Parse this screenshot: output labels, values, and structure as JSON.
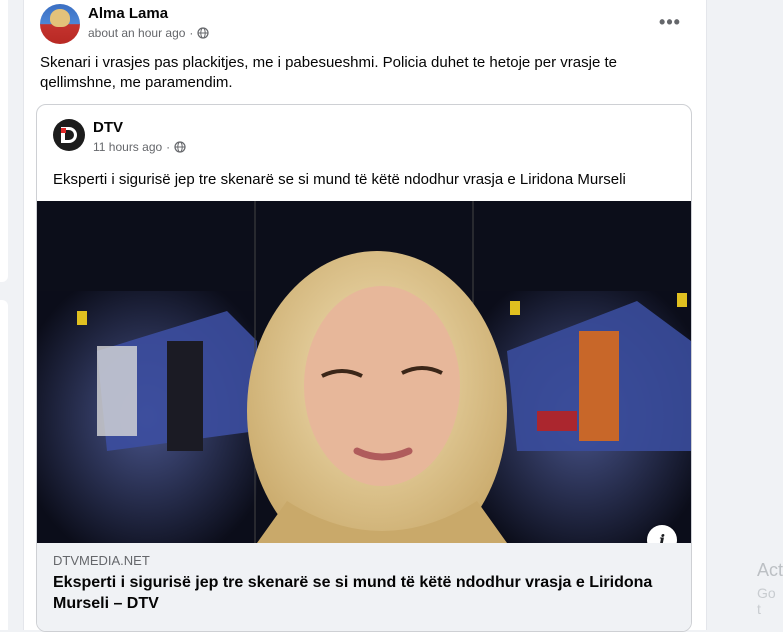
{
  "post": {
    "author": "Alma Lama",
    "time": "about an hour ago",
    "privacy_icon": "globe-icon",
    "more_icon": "more-options-icon",
    "caption": "Skenari i vrasjes pas plackitjes, me i pabesueshmi. Policia duhet te hetoje per vrasje te qellimshne, me paramendim."
  },
  "shared": {
    "page_name": "DTV",
    "time": "11 hours ago",
    "privacy_icon": "globe-icon",
    "text": "Eksperti i sigurisë jep tre skenarë se si mund të këtë ndodhur vrasja e Liridona Murseli",
    "link_domain": "DTVMEDIA.NET",
    "link_title": "Eksperti i sigurisë jep tre skenarë se si mund të këtë ndodhur vrasja e Liridona Murseli – DTV",
    "info_icon": "info-icon",
    "info_label": "i"
  },
  "right_panel": {
    "text1": "Act",
    "text2": "Go t"
  },
  "colors": {
    "background": "#f0f2f5",
    "card": "#ffffff",
    "secondary_text": "#65676b",
    "link_box": "#f0f2f5"
  }
}
